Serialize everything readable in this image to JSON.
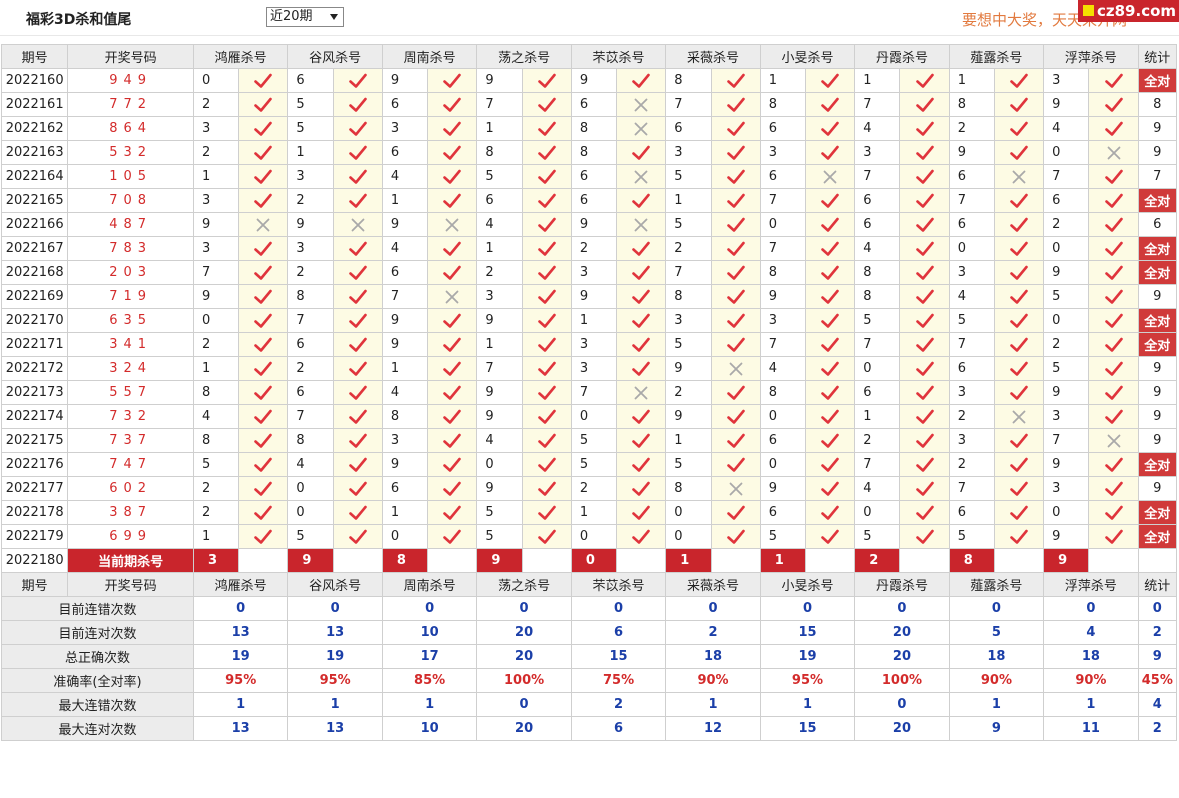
{
  "page": {
    "title": "福彩3D杀和值尾",
    "slogan": "要想中大奖，天天来开网",
    "logo": "cz89.com"
  },
  "filter": {
    "selected": "近20期"
  },
  "headers": [
    "期号",
    "开奖号码",
    "鸿雁杀号",
    "谷风杀号",
    "周南杀号",
    "荡之杀号",
    "芣苡杀号",
    "采薇杀号",
    "小旻杀号",
    "丹霞杀号",
    "薤露杀号",
    "浮萍杀号",
    "统计"
  ],
  "rows": [
    {
      "issue": "2022160",
      "nums": "949",
      "kills": [
        "0",
        "6",
        "9",
        "9",
        "9",
        "8",
        "1",
        "1",
        "1",
        "3"
      ],
      "hits": [
        1,
        1,
        1,
        1,
        1,
        1,
        1,
        1,
        1,
        1
      ],
      "total": "全对"
    },
    {
      "issue": "2022161",
      "nums": "772",
      "kills": [
        "2",
        "5",
        "6",
        "7",
        "6",
        "7",
        "8",
        "7",
        "8",
        "9"
      ],
      "hits": [
        1,
        1,
        1,
        1,
        0,
        1,
        1,
        1,
        1,
        1
      ],
      "total": "8"
    },
    {
      "issue": "2022162",
      "nums": "864",
      "kills": [
        "3",
        "5",
        "3",
        "1",
        "8",
        "6",
        "6",
        "4",
        "2",
        "4"
      ],
      "hits": [
        1,
        1,
        1,
        1,
        0,
        1,
        1,
        1,
        1,
        1
      ],
      "total": "9"
    },
    {
      "issue": "2022163",
      "nums": "532",
      "kills": [
        "2",
        "1",
        "6",
        "8",
        "8",
        "3",
        "3",
        "3",
        "9",
        "0"
      ],
      "hits": [
        1,
        1,
        1,
        1,
        1,
        1,
        1,
        1,
        1,
        0
      ],
      "total": "9"
    },
    {
      "issue": "2022164",
      "nums": "105",
      "kills": [
        "1",
        "3",
        "4",
        "5",
        "6",
        "5",
        "6",
        "7",
        "6",
        "7"
      ],
      "hits": [
        1,
        1,
        1,
        1,
        0,
        1,
        0,
        1,
        0,
        1
      ],
      "total": "7"
    },
    {
      "issue": "2022165",
      "nums": "708",
      "kills": [
        "3",
        "2",
        "1",
        "6",
        "6",
        "1",
        "7",
        "6",
        "7",
        "6"
      ],
      "hits": [
        1,
        1,
        1,
        1,
        1,
        1,
        1,
        1,
        1,
        1
      ],
      "total": "全对"
    },
    {
      "issue": "2022166",
      "nums": "487",
      "kills": [
        "9",
        "9",
        "9",
        "4",
        "9",
        "5",
        "0",
        "6",
        "6",
        "2"
      ],
      "hits": [
        0,
        0,
        0,
        1,
        0,
        1,
        1,
        1,
        1,
        1
      ],
      "total": "6"
    },
    {
      "issue": "2022167",
      "nums": "783",
      "kills": [
        "3",
        "3",
        "4",
        "1",
        "2",
        "2",
        "7",
        "4",
        "0",
        "0"
      ],
      "hits": [
        1,
        1,
        1,
        1,
        1,
        1,
        1,
        1,
        1,
        1
      ],
      "total": "全对"
    },
    {
      "issue": "2022168",
      "nums": "203",
      "kills": [
        "7",
        "2",
        "6",
        "2",
        "3",
        "7",
        "8",
        "8",
        "3",
        "9"
      ],
      "hits": [
        1,
        1,
        1,
        1,
        1,
        1,
        1,
        1,
        1,
        1
      ],
      "total": "全对"
    },
    {
      "issue": "2022169",
      "nums": "719",
      "kills": [
        "9",
        "8",
        "7",
        "3",
        "9",
        "8",
        "9",
        "8",
        "4",
        "5"
      ],
      "hits": [
        1,
        1,
        0,
        1,
        1,
        1,
        1,
        1,
        1,
        1
      ],
      "total": "9"
    },
    {
      "issue": "2022170",
      "nums": "635",
      "kills": [
        "0",
        "7",
        "9",
        "9",
        "1",
        "3",
        "3",
        "5",
        "5",
        "0"
      ],
      "hits": [
        1,
        1,
        1,
        1,
        1,
        1,
        1,
        1,
        1,
        1
      ],
      "total": "全对"
    },
    {
      "issue": "2022171",
      "nums": "341",
      "kills": [
        "2",
        "6",
        "9",
        "1",
        "3",
        "5",
        "7",
        "7",
        "7",
        "2"
      ],
      "hits": [
        1,
        1,
        1,
        1,
        1,
        1,
        1,
        1,
        1,
        1
      ],
      "total": "全对"
    },
    {
      "issue": "2022172",
      "nums": "324",
      "kills": [
        "1",
        "2",
        "1",
        "7",
        "3",
        "9",
        "4",
        "0",
        "6",
        "5"
      ],
      "hits": [
        1,
        1,
        1,
        1,
        1,
        0,
        1,
        1,
        1,
        1
      ],
      "total": "9"
    },
    {
      "issue": "2022173",
      "nums": "557",
      "kills": [
        "8",
        "6",
        "4",
        "9",
        "7",
        "2",
        "8",
        "6",
        "3",
        "9"
      ],
      "hits": [
        1,
        1,
        1,
        1,
        0,
        1,
        1,
        1,
        1,
        1
      ],
      "total": "9"
    },
    {
      "issue": "2022174",
      "nums": "732",
      "kills": [
        "4",
        "7",
        "8",
        "9",
        "0",
        "9",
        "0",
        "1",
        "2",
        "3"
      ],
      "hits": [
        1,
        1,
        1,
        1,
        1,
        1,
        1,
        1,
        0,
        1
      ],
      "total": "9"
    },
    {
      "issue": "2022175",
      "nums": "737",
      "kills": [
        "8",
        "8",
        "3",
        "4",
        "5",
        "1",
        "6",
        "2",
        "3",
        "7"
      ],
      "hits": [
        1,
        1,
        1,
        1,
        1,
        1,
        1,
        1,
        1,
        0
      ],
      "total": "9"
    },
    {
      "issue": "2022176",
      "nums": "747",
      "kills": [
        "5",
        "4",
        "9",
        "0",
        "5",
        "5",
        "0",
        "7",
        "2",
        "9"
      ],
      "hits": [
        1,
        1,
        1,
        1,
        1,
        1,
        1,
        1,
        1,
        1
      ],
      "total": "全对"
    },
    {
      "issue": "2022177",
      "nums": "602",
      "kills": [
        "2",
        "0",
        "6",
        "9",
        "2",
        "8",
        "9",
        "4",
        "7",
        "3"
      ],
      "hits": [
        1,
        1,
        1,
        1,
        1,
        0,
        1,
        1,
        1,
        1
      ],
      "total": "9"
    },
    {
      "issue": "2022178",
      "nums": "387",
      "kills": [
        "2",
        "0",
        "1",
        "5",
        "1",
        "0",
        "6",
        "0",
        "6",
        "0"
      ],
      "hits": [
        1,
        1,
        1,
        1,
        1,
        1,
        1,
        1,
        1,
        1
      ],
      "total": "全对"
    },
    {
      "issue": "2022179",
      "nums": "699",
      "kills": [
        "1",
        "5",
        "0",
        "5",
        "0",
        "0",
        "5",
        "5",
        "5",
        "9"
      ],
      "hits": [
        1,
        1,
        1,
        1,
        1,
        1,
        1,
        1,
        1,
        1
      ],
      "total": "全对"
    }
  ],
  "current": {
    "issue": "2022180",
    "label": "当前期杀号",
    "kills": [
      "3",
      "9",
      "8",
      "9",
      "0",
      "1",
      "1",
      "2",
      "8",
      "9"
    ]
  },
  "stats": [
    {
      "label": "目前连错次数",
      "values": [
        "0",
        "0",
        "0",
        "0",
        "0",
        "0",
        "0",
        "0",
        "0",
        "0"
      ],
      "total": "0",
      "red": false
    },
    {
      "label": "目前连对次数",
      "values": [
        "13",
        "13",
        "10",
        "20",
        "6",
        "2",
        "15",
        "20",
        "5",
        "4"
      ],
      "total": "2",
      "red": false
    },
    {
      "label": "总正确次数",
      "values": [
        "19",
        "19",
        "17",
        "20",
        "15",
        "18",
        "19",
        "20",
        "18",
        "18"
      ],
      "total": "9",
      "red": false
    },
    {
      "label": "准确率(全对率)",
      "values": [
        "95%",
        "95%",
        "85%",
        "100%",
        "75%",
        "90%",
        "95%",
        "100%",
        "90%",
        "90%"
      ],
      "total": "45%",
      "red": true
    },
    {
      "label": "最大连错次数",
      "values": [
        "1",
        "1",
        "1",
        "0",
        "2",
        "1",
        "1",
        "0",
        "1",
        "1"
      ],
      "total": "4",
      "red": false
    },
    {
      "label": "最大连对次数",
      "values": [
        "13",
        "13",
        "10",
        "20",
        "6",
        "12",
        "15",
        "20",
        "9",
        "11"
      ],
      "total": "2",
      "red": false
    }
  ],
  "colors": {
    "accent_red": "#c9252c",
    "stat_blue": "#1b3fa8",
    "mark_bg": "#fdfbe4",
    "header_bg": "#ececec"
  },
  "icons": {
    "hit": "check-icon",
    "miss": "cross-icon"
  }
}
